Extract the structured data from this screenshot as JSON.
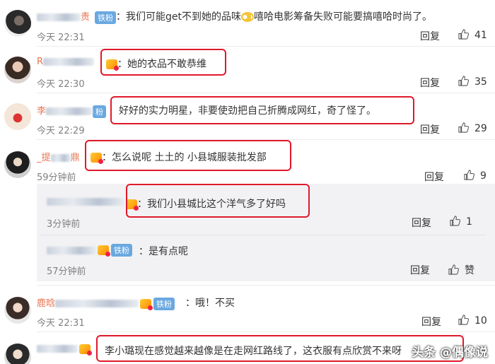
{
  "comments": [
    {
      "name_prefix": "",
      "name_suffix": "责",
      "badge": "铁粉",
      "text_a": "我们可能get不到她的品味",
      "text_b": "嘻哈电影筹备失败可能要搞嘻哈时尚了。",
      "time": "今天 22:31",
      "reply": "回复",
      "likes": "41"
    },
    {
      "name_prefix": "R",
      "name_suffix": "",
      "badge": "",
      "text": "她的衣品不敢恭维",
      "time": "今天 22:30",
      "reply": "回复",
      "likes": "35"
    },
    {
      "name_prefix": "李",
      "name_suffix": "粉",
      "badge": "",
      "text": "好好的实力明星，非要使劲把自己折腾成网红，奇了怪了。",
      "time": "今天 22:29",
      "reply": "回复",
      "likes": "29"
    },
    {
      "name_prefix": "_提",
      "name_suffix": "鼎",
      "badge": "",
      "text": "怎么说呢 土土的 小县城服装批发部",
      "time": "59分钟前",
      "reply": "回复",
      "likes": "9"
    },
    {
      "name_prefix": "",
      "name_suffix": "",
      "badge": "",
      "text": "我们小县城比这个洋气多了好吗",
      "time": "3分钟前",
      "reply": "回复",
      "likes": "1"
    },
    {
      "name_prefix": "",
      "name_suffix": "",
      "badge": "铁粉",
      "text": "是有点呢",
      "time": "57分钟前",
      "reply": "回复",
      "likes": "赞"
    },
    {
      "name_prefix": "鹿晗",
      "name_suffix": "",
      "badge": "铁粉",
      "text": "哦！不买",
      "time": "今天 22:31",
      "reply": "回复",
      "likes": "10"
    },
    {
      "name_prefix": "",
      "name_suffix": "",
      "badge": "",
      "text": "李小璐现在感觉越来越像是在走网红路线了，这衣服有点欣赏不来呀",
      "time": "",
      "reply": "",
      "likes": ""
    }
  ],
  "watermark": "头条 @偶像说",
  "colors": {
    "username": "#eb7350",
    "highlight_box": "#e0192b",
    "nested_bg": "#f2f2f5",
    "badge": "#6aa8e0"
  }
}
